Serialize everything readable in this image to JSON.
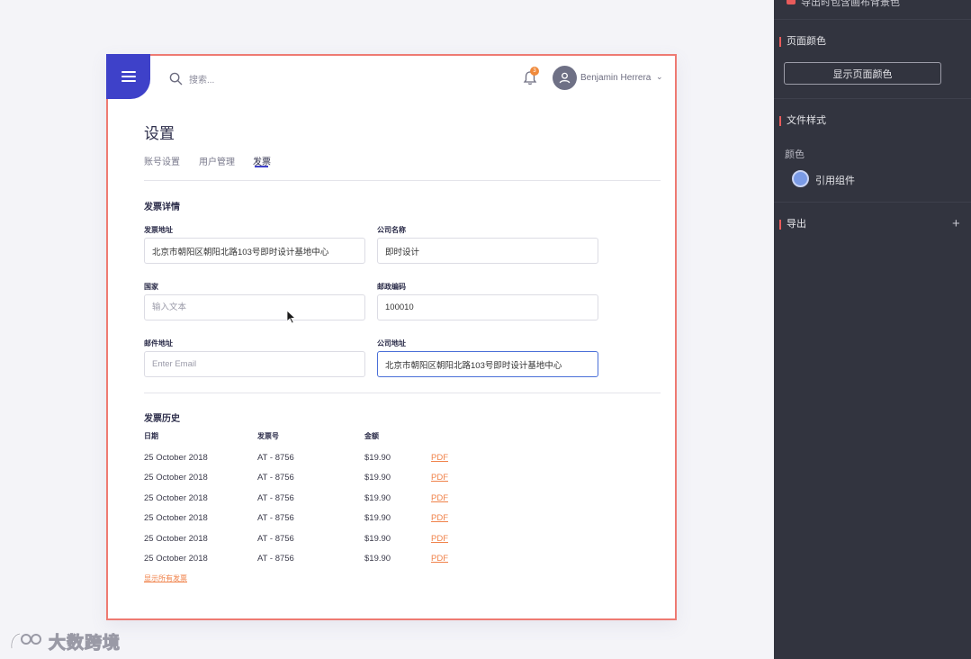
{
  "topbar": {
    "search_placeholder": "搜索...",
    "notification_count": "3",
    "user_name": "Benjamin Herrera",
    "caret": "⌄"
  },
  "page": {
    "title": "设置",
    "tabs": [
      {
        "label": "账号设置"
      },
      {
        "label": "用户管理"
      },
      {
        "label": "发票"
      }
    ]
  },
  "details": {
    "title": "发票详情",
    "fields": {
      "invoice_address": {
        "label": "发票地址",
        "value": "北京市朝阳区朝阳北路103号即时设计基地中心",
        "placeholder": ""
      },
      "company_name": {
        "label": "公司名称",
        "value": "即时设计",
        "placeholder": ""
      },
      "country": {
        "label": "国家",
        "value": "",
        "placeholder": "输入文本"
      },
      "postal_code": {
        "label": "邮政编码",
        "value": "100010",
        "placeholder": ""
      },
      "mail_address": {
        "label": "邮件地址",
        "value": "",
        "placeholder": "Enter Email"
      },
      "company_address": {
        "label": "公司地址",
        "value": "北京市朝阳区朝阳北路103号即时设计基地中心",
        "placeholder": ""
      }
    }
  },
  "history": {
    "title": "发票历史",
    "columns": [
      "日期",
      "发票号",
      "金额"
    ],
    "rows": [
      {
        "date": "25 October 2018",
        "number": "AT - 8756",
        "amount": "$19.90",
        "link": "PDF"
      },
      {
        "date": "25 October 2018",
        "number": "AT - 8756",
        "amount": "$19.90",
        "link": "PDF"
      },
      {
        "date": "25 October 2018",
        "number": "AT - 8756",
        "amount": "$19.90",
        "link": "PDF"
      },
      {
        "date": "25 October 2018",
        "number": "AT - 8756",
        "amount": "$19.90",
        "link": "PDF"
      },
      {
        "date": "25 October 2018",
        "number": "AT - 8756",
        "amount": "$19.90",
        "link": "PDF"
      },
      {
        "date": "25 October 2018",
        "number": "AT - 8756",
        "amount": "$19.90",
        "link": "PDF"
      }
    ],
    "show_all": "显示所有发票"
  },
  "panel": {
    "top_item": "导出时包含画布背景色",
    "page_color": {
      "title": "页面颜色",
      "button": "显示页面颜色"
    },
    "text_style": {
      "title": "文件样式",
      "sub": "颜色",
      "swatch_label": "引用组件",
      "swatch_color": "#7b9be6"
    },
    "export": {
      "title": "导出",
      "add": "+"
    }
  },
  "watermark": {
    "text": "大数跨境"
  },
  "colors": {
    "accent": "#3e41c9",
    "link": "#f0824a",
    "frame": "#ee7a72",
    "panel": "#32343f"
  }
}
